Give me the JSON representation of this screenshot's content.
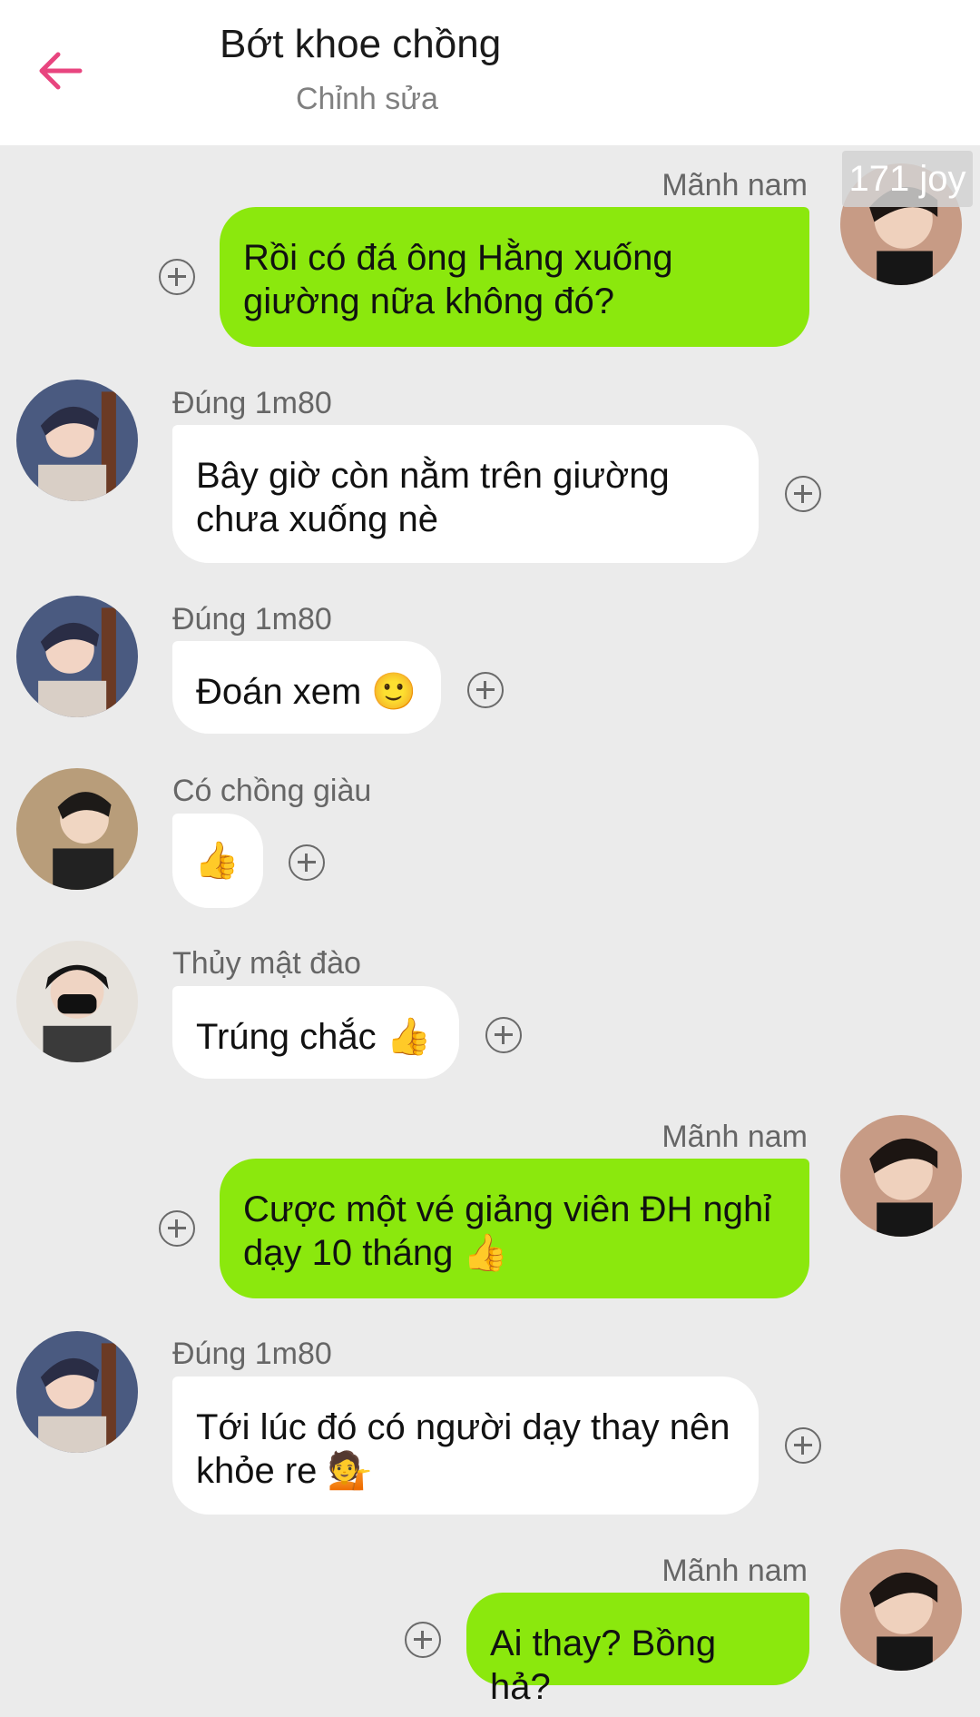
{
  "header": {
    "title": "Bớt khoe chồng",
    "subtitle": "Chỉnh sửa"
  },
  "watermark": "171 joy",
  "messages": [
    {
      "sender": "Mãnh nam",
      "line1": "Rồi có đá ông Hằng xuống",
      "line2": "giường nữa không đó?"
    },
    {
      "sender": "Đúng 1m80",
      "line1": "Bây giờ còn nằm trên giường",
      "line2": "chưa xuống nè"
    },
    {
      "sender": "Đúng 1m80",
      "line1": "Đoán xem 🙂"
    },
    {
      "sender": "Có chồng giàu",
      "line1": "👍"
    },
    {
      "sender": "Thủy mật đào",
      "line1": "Trúng chắc 👍"
    },
    {
      "sender": "Mãnh nam",
      "line1": "Cược một vé giảng viên ĐH nghỉ",
      "line2": "dạy 10 tháng 👍"
    },
    {
      "sender": "Đúng 1m80",
      "line1": "Tới lúc đó có người dạy thay nên",
      "line2": "khỏe re 💁"
    },
    {
      "sender": "Mãnh nam",
      "line1": "Ai thay? Bồng hả?"
    }
  ],
  "colors": {
    "accent": "#e8457f",
    "outgoing_bubble": "#8be80d",
    "incoming_bubble": "#ffffff",
    "background": "#ebebeb"
  },
  "icons": {
    "back": "arrow-left-icon",
    "reaction": "add-reaction-icon"
  }
}
